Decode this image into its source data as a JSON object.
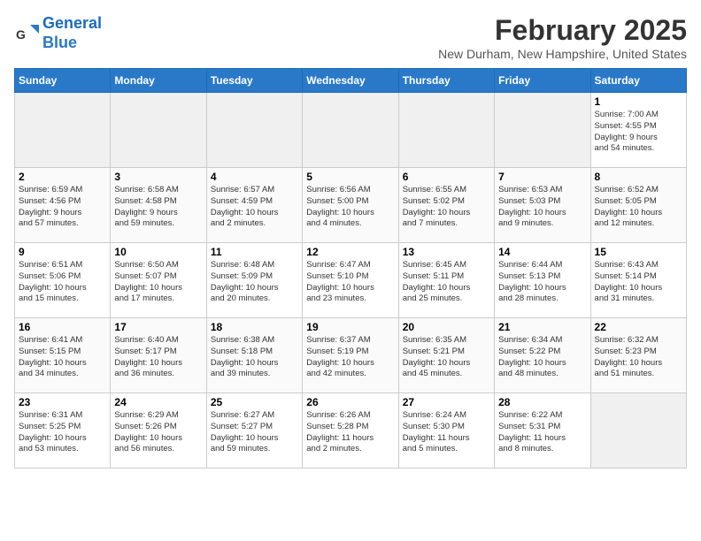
{
  "header": {
    "logo_line1": "General",
    "logo_line2": "Blue",
    "month_title": "February 2025",
    "location": "New Durham, New Hampshire, United States"
  },
  "weekdays": [
    "Sunday",
    "Monday",
    "Tuesday",
    "Wednesday",
    "Thursday",
    "Friday",
    "Saturday"
  ],
  "weeks": [
    [
      {
        "day": "",
        "empty": true
      },
      {
        "day": "",
        "empty": true
      },
      {
        "day": "",
        "empty": true
      },
      {
        "day": "",
        "empty": true
      },
      {
        "day": "",
        "empty": true
      },
      {
        "day": "",
        "empty": true
      },
      {
        "day": "1",
        "info": "Sunrise: 7:00 AM\nSunset: 4:55 PM\nDaylight: 9 hours\nand 54 minutes."
      }
    ],
    [
      {
        "day": "2",
        "info": "Sunrise: 6:59 AM\nSunset: 4:56 PM\nDaylight: 9 hours\nand 57 minutes."
      },
      {
        "day": "3",
        "info": "Sunrise: 6:58 AM\nSunset: 4:58 PM\nDaylight: 9 hours\nand 59 minutes."
      },
      {
        "day": "4",
        "info": "Sunrise: 6:57 AM\nSunset: 4:59 PM\nDaylight: 10 hours\nand 2 minutes."
      },
      {
        "day": "5",
        "info": "Sunrise: 6:56 AM\nSunset: 5:00 PM\nDaylight: 10 hours\nand 4 minutes."
      },
      {
        "day": "6",
        "info": "Sunrise: 6:55 AM\nSunset: 5:02 PM\nDaylight: 10 hours\nand 7 minutes."
      },
      {
        "day": "7",
        "info": "Sunrise: 6:53 AM\nSunset: 5:03 PM\nDaylight: 10 hours\nand 9 minutes."
      },
      {
        "day": "8",
        "info": "Sunrise: 6:52 AM\nSunset: 5:05 PM\nDaylight: 10 hours\nand 12 minutes."
      }
    ],
    [
      {
        "day": "9",
        "info": "Sunrise: 6:51 AM\nSunset: 5:06 PM\nDaylight: 10 hours\nand 15 minutes."
      },
      {
        "day": "10",
        "info": "Sunrise: 6:50 AM\nSunset: 5:07 PM\nDaylight: 10 hours\nand 17 minutes."
      },
      {
        "day": "11",
        "info": "Sunrise: 6:48 AM\nSunset: 5:09 PM\nDaylight: 10 hours\nand 20 minutes."
      },
      {
        "day": "12",
        "info": "Sunrise: 6:47 AM\nSunset: 5:10 PM\nDaylight: 10 hours\nand 23 minutes."
      },
      {
        "day": "13",
        "info": "Sunrise: 6:45 AM\nSunset: 5:11 PM\nDaylight: 10 hours\nand 25 minutes."
      },
      {
        "day": "14",
        "info": "Sunrise: 6:44 AM\nSunset: 5:13 PM\nDaylight: 10 hours\nand 28 minutes."
      },
      {
        "day": "15",
        "info": "Sunrise: 6:43 AM\nSunset: 5:14 PM\nDaylight: 10 hours\nand 31 minutes."
      }
    ],
    [
      {
        "day": "16",
        "info": "Sunrise: 6:41 AM\nSunset: 5:15 PM\nDaylight: 10 hours\nand 34 minutes."
      },
      {
        "day": "17",
        "info": "Sunrise: 6:40 AM\nSunset: 5:17 PM\nDaylight: 10 hours\nand 36 minutes."
      },
      {
        "day": "18",
        "info": "Sunrise: 6:38 AM\nSunset: 5:18 PM\nDaylight: 10 hours\nand 39 minutes."
      },
      {
        "day": "19",
        "info": "Sunrise: 6:37 AM\nSunset: 5:19 PM\nDaylight: 10 hours\nand 42 minutes."
      },
      {
        "day": "20",
        "info": "Sunrise: 6:35 AM\nSunset: 5:21 PM\nDaylight: 10 hours\nand 45 minutes."
      },
      {
        "day": "21",
        "info": "Sunrise: 6:34 AM\nSunset: 5:22 PM\nDaylight: 10 hours\nand 48 minutes."
      },
      {
        "day": "22",
        "info": "Sunrise: 6:32 AM\nSunset: 5:23 PM\nDaylight: 10 hours\nand 51 minutes."
      }
    ],
    [
      {
        "day": "23",
        "info": "Sunrise: 6:31 AM\nSunset: 5:25 PM\nDaylight: 10 hours\nand 53 minutes."
      },
      {
        "day": "24",
        "info": "Sunrise: 6:29 AM\nSunset: 5:26 PM\nDaylight: 10 hours\nand 56 minutes."
      },
      {
        "day": "25",
        "info": "Sunrise: 6:27 AM\nSunset: 5:27 PM\nDaylight: 10 hours\nand 59 minutes."
      },
      {
        "day": "26",
        "info": "Sunrise: 6:26 AM\nSunset: 5:28 PM\nDaylight: 11 hours\nand 2 minutes."
      },
      {
        "day": "27",
        "info": "Sunrise: 6:24 AM\nSunset: 5:30 PM\nDaylight: 11 hours\nand 5 minutes."
      },
      {
        "day": "28",
        "info": "Sunrise: 6:22 AM\nSunset: 5:31 PM\nDaylight: 11 hours\nand 8 minutes."
      },
      {
        "day": "",
        "empty": true
      }
    ]
  ]
}
